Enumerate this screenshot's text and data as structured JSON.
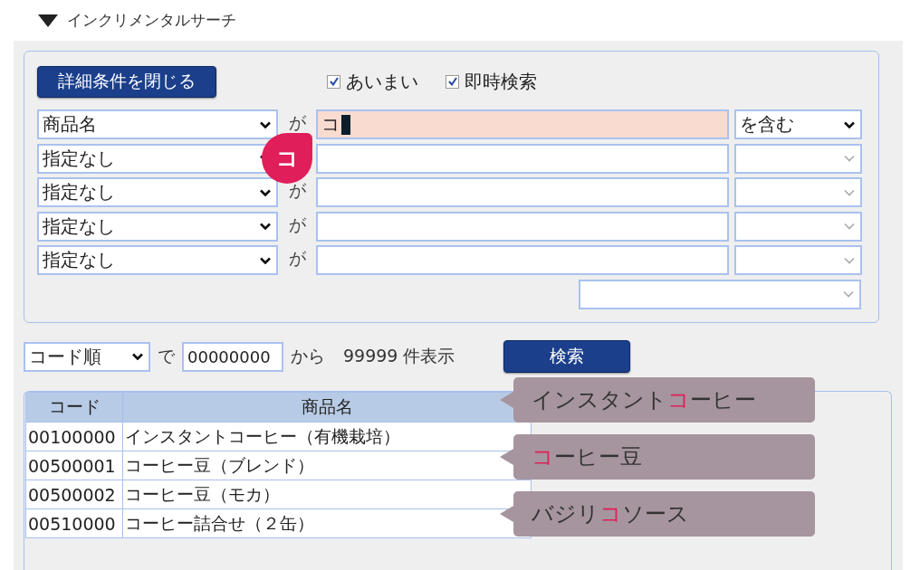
{
  "section": {
    "title": "インクリメンタルサーチ",
    "expanded": true
  },
  "search_panel": {
    "close_button": "詳細条件を閉じる",
    "options": [
      {
        "label": "あいまい",
        "checked": true
      },
      {
        "label": "即時検索",
        "checked": true
      }
    ],
    "conditions": [
      {
        "field": "商品名",
        "connector": "が",
        "value": "コ",
        "focused": true,
        "operator": "を含む",
        "operator_enabled": true
      },
      {
        "field": "指定なし",
        "focused": false,
        "operator_enabled": false
      },
      {
        "field": "指定なし",
        "connector": "が",
        "focused": false,
        "operator_enabled": false
      },
      {
        "field": "指定なし",
        "connector": "が",
        "focused": false,
        "operator_enabled": false
      },
      {
        "field": "指定なし",
        "connector": "が",
        "focused": false,
        "operator_enabled": false
      }
    ],
    "extra_select": {
      "operator_enabled": false
    },
    "callout": "コ"
  },
  "sort_bar": {
    "order": "コード順",
    "by": "で",
    "start": "00000000",
    "from": "から",
    "count": "99999 件表示",
    "search_button": "検索"
  },
  "table": {
    "columns": [
      "コード",
      "商品名"
    ],
    "rows": [
      [
        "00100000",
        "インスタントコーヒー（有機栽培）"
      ],
      [
        "00500001",
        "コーヒー豆（ブレンド）"
      ],
      [
        "00500002",
        "コーヒー豆（モカ）"
      ],
      [
        "00510000",
        "コーヒー詰合せ（２缶）"
      ]
    ]
  },
  "suggestions": [
    [
      {
        "text": "インスタント",
        "highlight": false
      },
      {
        "text": "コ",
        "highlight": true
      },
      {
        "text": "ーヒー",
        "highlight": false
      }
    ],
    [
      {
        "text": "コ",
        "highlight": true
      },
      {
        "text": "ーヒー豆",
        "highlight": false
      }
    ],
    [
      {
        "text": "バジリ",
        "highlight": false
      },
      {
        "text": "コ",
        "highlight": true
      },
      {
        "text": "ソース",
        "highlight": false
      }
    ]
  ]
}
